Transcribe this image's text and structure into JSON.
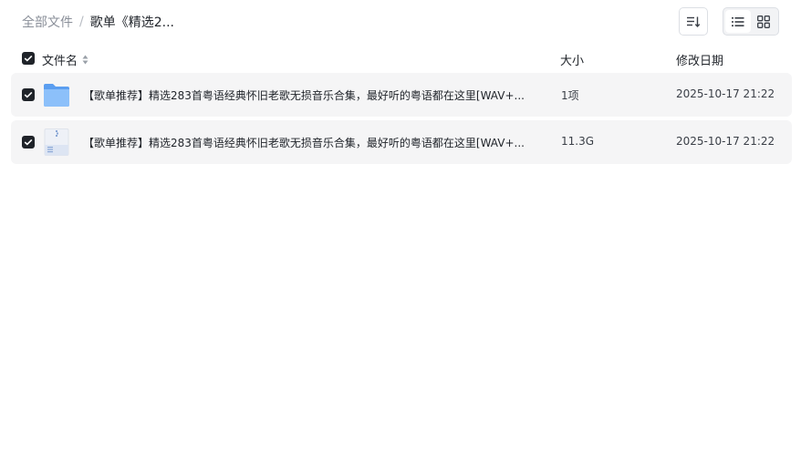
{
  "breadcrumb": {
    "root": "全部文件",
    "separator": "/",
    "current": "歌单《精选2..."
  },
  "toolbar": {
    "sort_icon": "sort-descending-icon",
    "list_view_icon": "list-view-icon",
    "grid_view_icon": "grid-view-icon",
    "active_view": "list"
  },
  "table": {
    "columns": {
      "name": "文件名",
      "size": "大小",
      "modified": "修改日期"
    },
    "rows": [
      {
        "type": "folder",
        "icon": "folder-icon",
        "name": "【歌单推荐】精选283首粤语经典怀旧老歌无损音乐合集，最好听的粤语都在这里[WAV+...",
        "size": "1项",
        "modified": "2025-10-17 21:22",
        "checked": true
      },
      {
        "type": "archive",
        "icon": "archive-file-icon",
        "name": "【歌单推荐】精选283首粤语经典怀旧老歌无损音乐合集，最好听的粤语都在这里[WAV+...",
        "size": "11.3G",
        "modified": "2025-10-17 21:22",
        "checked": true
      }
    ]
  },
  "colors": {
    "accent_folder": "#69a8f5",
    "row_background": "#f5f5f6",
    "checkbox": "#1f2329"
  }
}
